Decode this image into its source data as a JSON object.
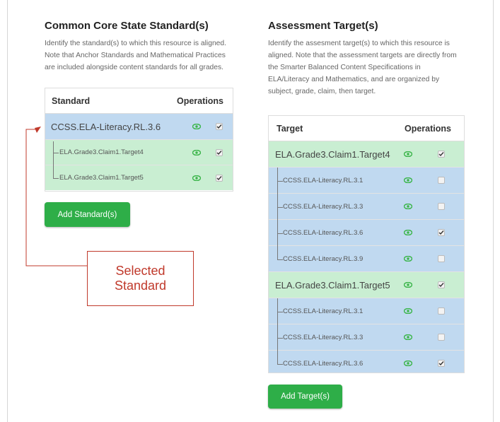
{
  "left": {
    "title": "Common Core State Standard(s)",
    "description_lines": [
      "Identify the standard(s) to which this resource is aligned.",
      "Note that Anchor Standards and Mathematical Practices",
      "are included alongside content standards for all grades."
    ],
    "table": {
      "col_standard": "Standard",
      "col_operations": "Operations",
      "parent": "CCSS.ELA-Literacy.RL.3.6",
      "children": [
        "ELA.Grade3.Claim1.Target4",
        "ELA.Grade3.Claim1.Target5"
      ]
    },
    "add_button": "Add Standard(s)"
  },
  "right": {
    "title": "Assessment Target(s)",
    "description_lines": [
      "Identify the assesment target(s) to which this resource is",
      "aligned. Note that the assessment targets are directly from",
      "the Smarter Balanced Content Specifications in",
      "ELA/Literacy and Mathematics, and are organized by",
      "subject, grade, claim, then target."
    ],
    "table": {
      "col_target": "Target",
      "col_operations": "Operations",
      "groups": [
        {
          "name": "ELA.Grade3.Claim1.Target4",
          "checked": true,
          "children": [
            {
              "name": "CCSS.ELA-Literacy.RL.3.1",
              "checked": false
            },
            {
              "name": "CCSS.ELA-Literacy.RL.3.3",
              "checked": false
            },
            {
              "name": "CCSS.ELA-Literacy.RL.3.6",
              "checked": true
            },
            {
              "name": "CCSS.ELA-Literacy.RL.3.9",
              "checked": false
            }
          ]
        },
        {
          "name": "ELA.Grade3.Claim1.Target5",
          "checked": true,
          "children": [
            {
              "name": "CCSS.ELA-Literacy.RL.3.1",
              "checked": false
            },
            {
              "name": "CCSS.ELA-Literacy.RL.3.3",
              "checked": false
            },
            {
              "name": "CCSS.ELA-Literacy.RL.3.6",
              "checked": true
            }
          ]
        }
      ]
    },
    "add_button": "Add Target(s)"
  },
  "callout": {
    "line1": "Selected",
    "line2": "Standard"
  },
  "colors": {
    "accent_green": "#2eae48",
    "row_blue": "#c0d9f0",
    "row_green": "#c9eed2",
    "eye_green": "#3bb54a",
    "callout_red": "#c0392b"
  }
}
